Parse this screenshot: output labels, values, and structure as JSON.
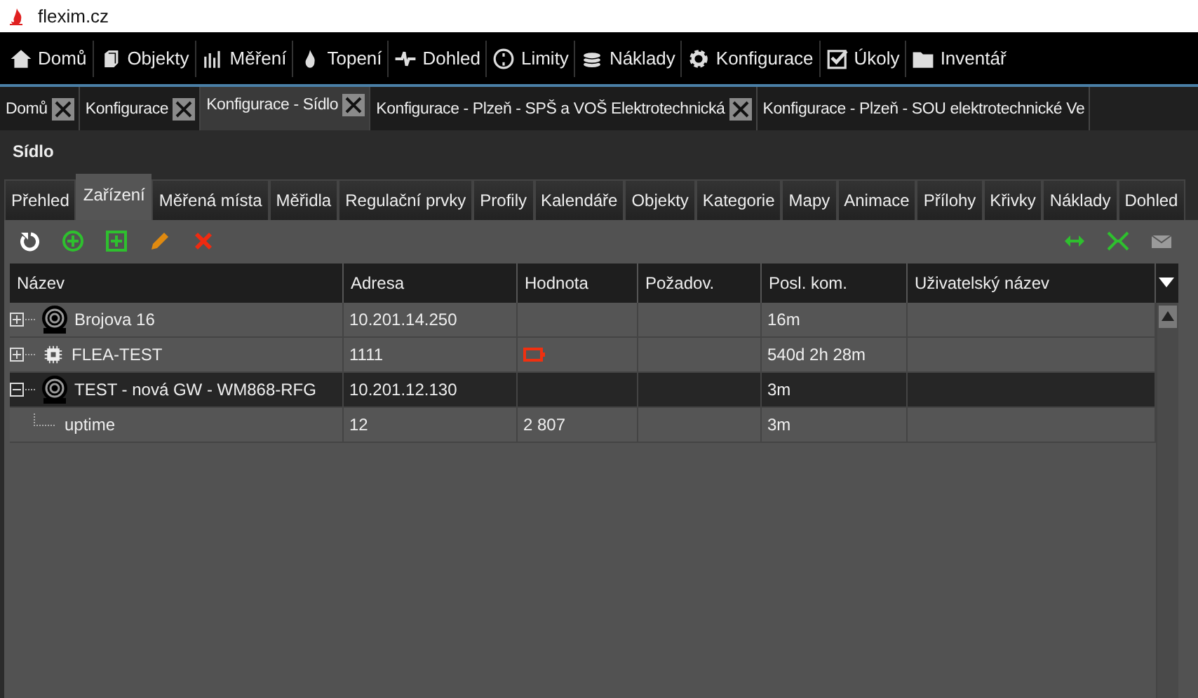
{
  "browser": {
    "title": "flexim.cz"
  },
  "menu": [
    {
      "label": "Domů",
      "kind": "home"
    },
    {
      "label": "Objekty",
      "kind": "cube"
    },
    {
      "label": "Měření",
      "kind": "bars"
    },
    {
      "label": "Topení",
      "kind": "flame"
    },
    {
      "label": "Dohled",
      "kind": "pulse"
    },
    {
      "label": "Limity",
      "kind": "circle"
    },
    {
      "label": "Náklady",
      "kind": "coins"
    },
    {
      "label": "Konfigurace",
      "kind": "gear"
    },
    {
      "label": "Úkoly",
      "kind": "check"
    },
    {
      "label": "Inventář",
      "kind": "folder"
    }
  ],
  "doc_tabs": [
    {
      "label": "Domů",
      "selected": false,
      "closable": true
    },
    {
      "label": "Konfigurace",
      "selected": false,
      "closable": true
    },
    {
      "label": "Konfigurace - Sídlo",
      "selected": true,
      "closable": true
    },
    {
      "label": "Konfigurace - Plzeň - SPŠ a VOŠ Elektrotechnická",
      "selected": false,
      "closable": true
    },
    {
      "label": "Konfigurace - Plzeň - SOU elektrotechnické Ve",
      "selected": false,
      "closable": false
    }
  ],
  "page_title": "Sídlo",
  "sub_tabs": [
    {
      "label": "Přehled",
      "selected": false
    },
    {
      "label": "Zařízení",
      "selected": true
    },
    {
      "label": "Měřená místa",
      "selected": false
    },
    {
      "label": "Měřidla",
      "selected": false
    },
    {
      "label": "Regulační prvky",
      "selected": false
    },
    {
      "label": "Profily",
      "selected": false
    },
    {
      "label": "Kalendáře",
      "selected": false
    },
    {
      "label": "Objekty",
      "selected": false
    },
    {
      "label": "Kategorie",
      "selected": false
    },
    {
      "label": "Mapy",
      "selected": false
    },
    {
      "label": "Animace",
      "selected": false
    },
    {
      "label": "Přílohy",
      "selected": false
    },
    {
      "label": "Křivky",
      "selected": false
    },
    {
      "label": "Náklady",
      "selected": false
    },
    {
      "label": "Dohled",
      "selected": false
    }
  ],
  "toolbar_left": [
    {
      "kind": "refresh"
    },
    {
      "kind": "add-circle"
    },
    {
      "kind": "add-square"
    },
    {
      "kind": "edit"
    },
    {
      "kind": "delete"
    }
  ],
  "toolbar_right": [
    {
      "kind": "swap",
      "disabled": false
    },
    {
      "kind": "disconnect",
      "disabled": false
    },
    {
      "kind": "mail",
      "disabled": true
    }
  ],
  "table": {
    "columns": [
      "Název",
      "Adresa",
      "Hodnota",
      "Požadov.",
      "Posl. kom.",
      "Uživatelský název"
    ],
    "rows": [
      {
        "name": "Brojova 16",
        "kind": "gateway",
        "address": "10.201.14.250",
        "battery_alert": false,
        "last": "16m",
        "expanded": false,
        "selected": false
      },
      {
        "name": "FLEA-TEST",
        "kind": "chip",
        "address": "1111",
        "battery_alert": true,
        "last": "540d 2h 28m",
        "expanded": false,
        "selected": false
      },
      {
        "name": "TEST - nová GW - WM868-RFG",
        "kind": "gateway",
        "address": "10.201.12.130",
        "battery_alert": false,
        "last": "3m",
        "expanded": true,
        "selected": true,
        "children": [
          {
            "name": "uptime",
            "address": "12",
            "value": "2 807",
            "last": "3m",
            "selected": false
          }
        ]
      }
    ]
  }
}
